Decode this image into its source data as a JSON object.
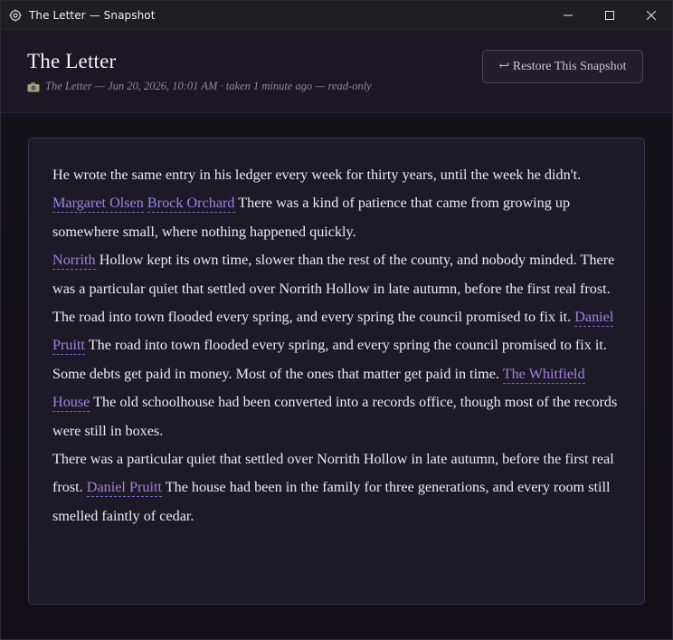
{
  "window": {
    "title": "The Letter — Snapshot"
  },
  "header": {
    "title": "The Letter",
    "subtitle": "The Letter — Jun 20, 2026, 10:01 AM · taken 1 minute ago — read-only",
    "restore_label": "↩ Restore This Snapshot"
  },
  "paragraphs": [
    {
      "before": "He wrote the same entry in his ledger every week for thirty years, until the week he didn't. ",
      "links": [
        "Margaret Olsen",
        "Brock Orchard"
      ],
      "after": " There was a kind of patience that came from growing up somewhere small, where nothing happened quickly."
    },
    {
      "before": "",
      "links": [
        "Norrith"
      ],
      "after": " Hollow kept its own time, slower than the rest of the county, and nobody minded. There was a particular quiet that settled over Norrith Hollow in late autumn, before the first real frost."
    },
    {
      "before": "The road into town flooded every spring, and every spring the council promised to fix it. ",
      "links": [
        "Daniel Pruitt"
      ],
      "after": " The road into town flooded every spring, and every spring the council promised to fix it."
    },
    {
      "before": "Some debts get paid in money. Most of the ones that matter get paid in time. ",
      "links": [
        "The Whitfield House"
      ],
      "after": " The old schoolhouse had been converted into a records office, though most of the records were still in boxes."
    },
    {
      "before": "There was a particular quiet that settled over Norrith Hollow in late autumn, before the first real frost. ",
      "links": [
        "Daniel Pruitt"
      ],
      "after": " The house had been in the family for three generations, and every room still smelled faintly of cedar."
    }
  ]
}
